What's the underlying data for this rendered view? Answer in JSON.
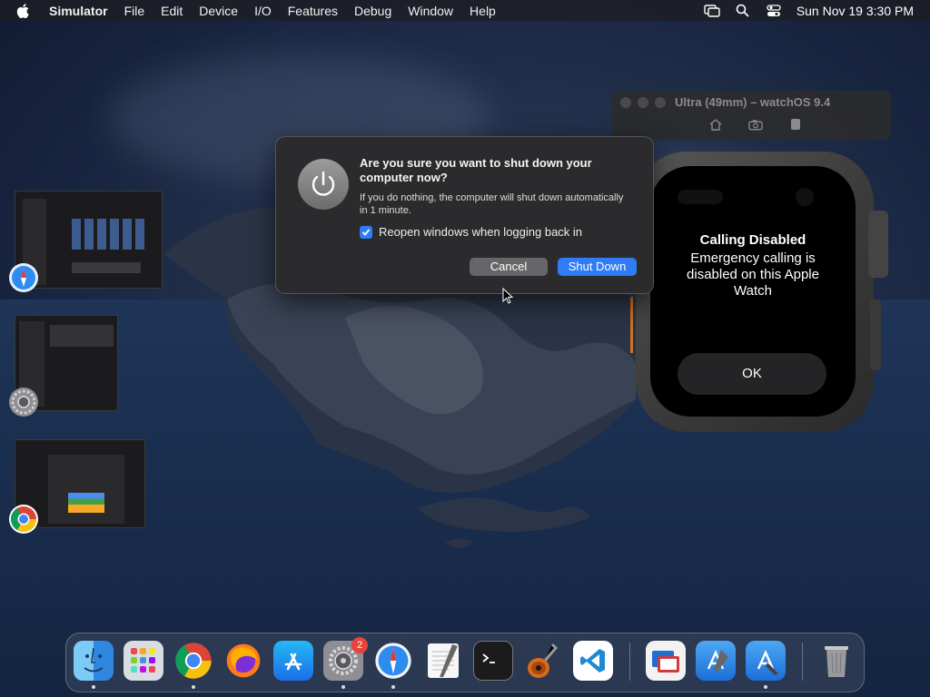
{
  "menubar": {
    "app_name": "Simulator",
    "items": [
      "File",
      "Edit",
      "Device",
      "I/O",
      "Features",
      "Debug",
      "Window",
      "Help"
    ],
    "clock": "Sun Nov 19  3:30 PM"
  },
  "dialog": {
    "title": "Are you sure you want to shut down your computer now?",
    "message": "If you do nothing, the computer will shut down automatically in 1 minute.",
    "checkbox_label": "Reopen windows when logging back in",
    "checkbox_checked": true,
    "cancel_label": "Cancel",
    "confirm_label": "Shut Down",
    "accent_color": "#2e7cf6"
  },
  "simulator": {
    "window_title": "Ultra (49mm) – watchOS 9.4",
    "toolbar_icons": [
      "home-icon",
      "screenshot-icon",
      "rotate-icon"
    ]
  },
  "watch": {
    "title": "Calling Disabled",
    "message": "Emergency calling is disabled on this Apple Watch",
    "ok_label": "OK"
  },
  "dock": {
    "apps": [
      "finder",
      "launchpad",
      "chrome",
      "firefox",
      "app-store",
      "system-settings",
      "safari",
      "textedit",
      "terminal",
      "garageband",
      "vscode",
      "screens",
      "xcode",
      "simulator-dev",
      "trash"
    ],
    "settings_badge": "2"
  }
}
